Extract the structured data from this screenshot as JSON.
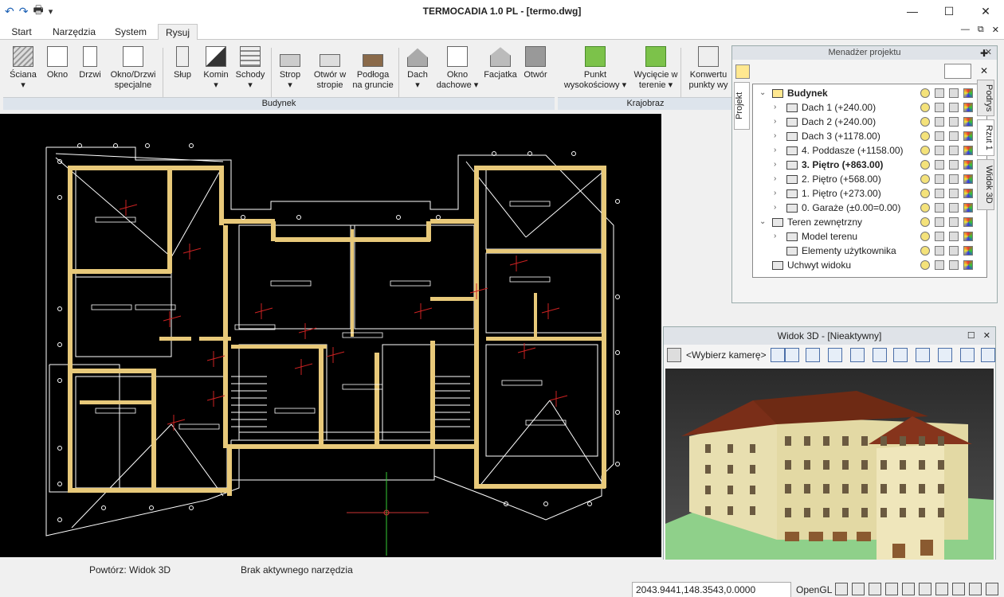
{
  "window": {
    "title": "TERMOCADIA 1.0 PL - [termo.dwg]"
  },
  "quick_access": {
    "undo": "↶",
    "redo": "↷",
    "print": "🖶",
    "more": "▾"
  },
  "window_controls": {
    "minimize": "—",
    "maximize": "☐",
    "close": "✕"
  },
  "menu": {
    "tabs": [
      {
        "label": "Start"
      },
      {
        "label": "Narzędzia"
      },
      {
        "label": "System"
      },
      {
        "label": "Rysuj"
      }
    ],
    "active": "Rysuj",
    "mdi": {
      "minimize": "—",
      "restore": "⧉",
      "close": "✕"
    }
  },
  "ribbon": {
    "groups": [
      {
        "label": "Budynek"
      },
      {
        "label": "Krajobraz"
      }
    ],
    "buttons": [
      {
        "label": "Ściana",
        "sub": "▾"
      },
      {
        "label": "Okno",
        "sub": ""
      },
      {
        "label": "Drzwi",
        "sub": ""
      },
      {
        "label": "Okno/Drzwi",
        "sub": "specjalne"
      },
      {
        "label": "Słup",
        "sub": ""
      },
      {
        "label": "Komin",
        "sub": "▾"
      },
      {
        "label": "Schody",
        "sub": "▾"
      },
      {
        "label": "Strop",
        "sub": "▾"
      },
      {
        "label": "Otwór w",
        "sub": "stropie"
      },
      {
        "label": "Podłoga",
        "sub": "na gruncie"
      },
      {
        "label": "Dach",
        "sub": "▾"
      },
      {
        "label": "Okno",
        "sub": "dachowe ▾"
      },
      {
        "label": "Facjatka",
        "sub": ""
      },
      {
        "label": "Otwór",
        "sub": ""
      },
      {
        "label": "Punkt",
        "sub": "wysokościowy ▾"
      },
      {
        "label": "Wycięcie w",
        "sub": "terenie ▾"
      },
      {
        "label": "Konwertu",
        "sub": "punkty wy"
      }
    ]
  },
  "project_manager": {
    "title": "Menadżer projektu",
    "close": "✕",
    "side_tab": "Projekt",
    "tree": [
      {
        "label": "Budynek",
        "level": 0,
        "expander": "⌄",
        "bold": true
      },
      {
        "label": "Dach 1 (+240.00)",
        "level": 1,
        "expander": "›",
        "bold": false
      },
      {
        "label": "Dach 2 (+240.00)",
        "level": 1,
        "expander": "›",
        "bold": false
      },
      {
        "label": "Dach 3 (+1178.00)",
        "level": 1,
        "expander": "›",
        "bold": false
      },
      {
        "label": "4. Poddasze (+1158.00)",
        "level": 1,
        "expander": "›",
        "bold": false
      },
      {
        "label": "3. Piętro (+863.00)",
        "level": 1,
        "expander": "›",
        "bold": true
      },
      {
        "label": "2. Piętro (+568.00)",
        "level": 1,
        "expander": "›",
        "bold": false
      },
      {
        "label": "1. Piętro (+273.00)",
        "level": 1,
        "expander": "›",
        "bold": false
      },
      {
        "label": "0. Garaże (±0.00=0.00)",
        "level": 1,
        "expander": "›",
        "bold": false
      },
      {
        "label": "Teren zewnętrzny",
        "level": 0,
        "expander": "⌄",
        "bold": false
      },
      {
        "label": "Model terenu",
        "level": 1,
        "expander": "›",
        "bold": false
      },
      {
        "label": "Elementy użytkownika",
        "level": 1,
        "expander": "",
        "bold": false
      },
      {
        "label": "Uchwyt widoku",
        "level": 0,
        "expander": "",
        "bold": false
      }
    ]
  },
  "right_tabs": [
    {
      "label": "Podrys"
    },
    {
      "label": "Rzut 1"
    },
    {
      "label": "Widok 3D"
    }
  ],
  "side_icons": {
    "pin": "✚",
    "close": "✕"
  },
  "view3d": {
    "title": "Widok 3D - [Nieaktywny]",
    "camera_placeholder": "<Wybierz kamerę>",
    "restore": "☐",
    "close": "✕"
  },
  "status": {
    "repeat": "Powtórz: Widok 3D",
    "tool": "Brak aktywnego narzędzia",
    "coords": "2043.9441,148.3543,0.0000",
    "renderer": "OpenGL"
  },
  "colors": {
    "wall": "#e8c97a",
    "line": "#ffffff",
    "dim_red": "#cc2222",
    "ground": "#8fd08a",
    "roof": "#7a2e18",
    "facade": "#e8dfb0"
  }
}
